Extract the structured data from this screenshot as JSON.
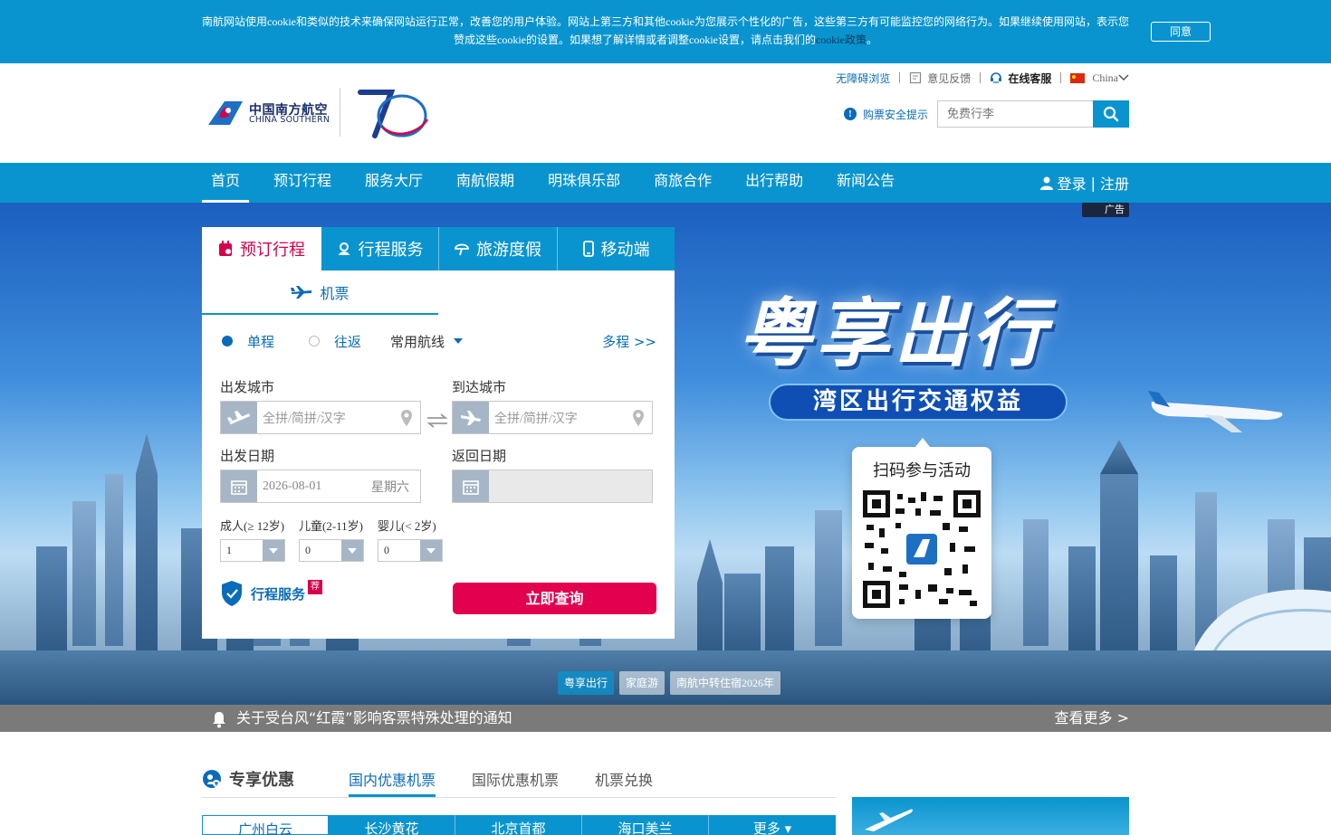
{
  "cookie": {
    "text": "南航网站使用cookie和类似的技术来确保网站运行正常，改善您的用户体验。网站上第三方和其他cookie为您展示个性化的广告，这些第三方有可能监控您的网络行为。如果继续使用网站，表示您赞成这些cookie的设置。如果想了解详情或者调整cookie设置，请点击我们的",
    "link": "cookie政策",
    "end": "。",
    "accept": "同意"
  },
  "topbar": {
    "accessibility": "无障碍浏览",
    "feedback": "意见反馈",
    "online_service": "在线客服",
    "country": "China"
  },
  "logo": {
    "cn": "中国南方航空",
    "en": "CHINA SOUTHERN"
  },
  "header": {
    "safety_tip": "购票安全提示",
    "search_placeholder": "免费行李"
  },
  "nav": {
    "items": [
      "首页",
      "预订行程",
      "服务大厅",
      "南航假期",
      "明珠俱乐部",
      "商旅合作",
      "出行帮助",
      "新闻公告"
    ],
    "login": "登录",
    "register": "注册"
  },
  "hero": {
    "ad": "广告",
    "title": "粤享出行",
    "subtitle": "湾区出行交通权益",
    "qr_title": "扫码参与活动",
    "slides": [
      "粤享出行",
      "家庭游",
      "南航中转住宿2026年"
    ]
  },
  "booking": {
    "tabs": [
      "预订行程",
      "行程服务",
      "旅游度假",
      "移动端"
    ],
    "sub_tab": "机票",
    "one_way": "单程",
    "round_trip": "往返",
    "routes": "常用航线",
    "multi": "多程 >>",
    "from_label": "出发城市",
    "to_label": "到达城市",
    "city_placeholder": "全拼/简拼/汉字",
    "depart_label": "出发日期",
    "return_label": "返回日期",
    "depart_date": "2026-08-01",
    "weekday": "星期六",
    "adult_label": "成人(≥ 12岁)",
    "child_label": "儿童(2-11岁)",
    "infant_label": "婴儿(< 2岁)",
    "adult": "1",
    "child": "0",
    "infant": "0",
    "service": "行程服务",
    "service_badge": "荐",
    "search": "立即查询"
  },
  "notice": {
    "text": "关于受台风“红霞”影响客票特殊处理的通知",
    "more": "查看更多 >"
  },
  "deals": {
    "title": "专享优惠",
    "tabs": [
      "国内优惠机票",
      "国际优惠机票",
      "机票兑换"
    ],
    "cities": [
      "广州白云",
      "长沙黄花",
      "北京首都",
      "海口美兰",
      "更多 ▾"
    ]
  },
  "colors": {
    "brand_blue": "#0a94cf",
    "accent_red": "#e2004f",
    "link_blue": "#0a6bb8"
  }
}
